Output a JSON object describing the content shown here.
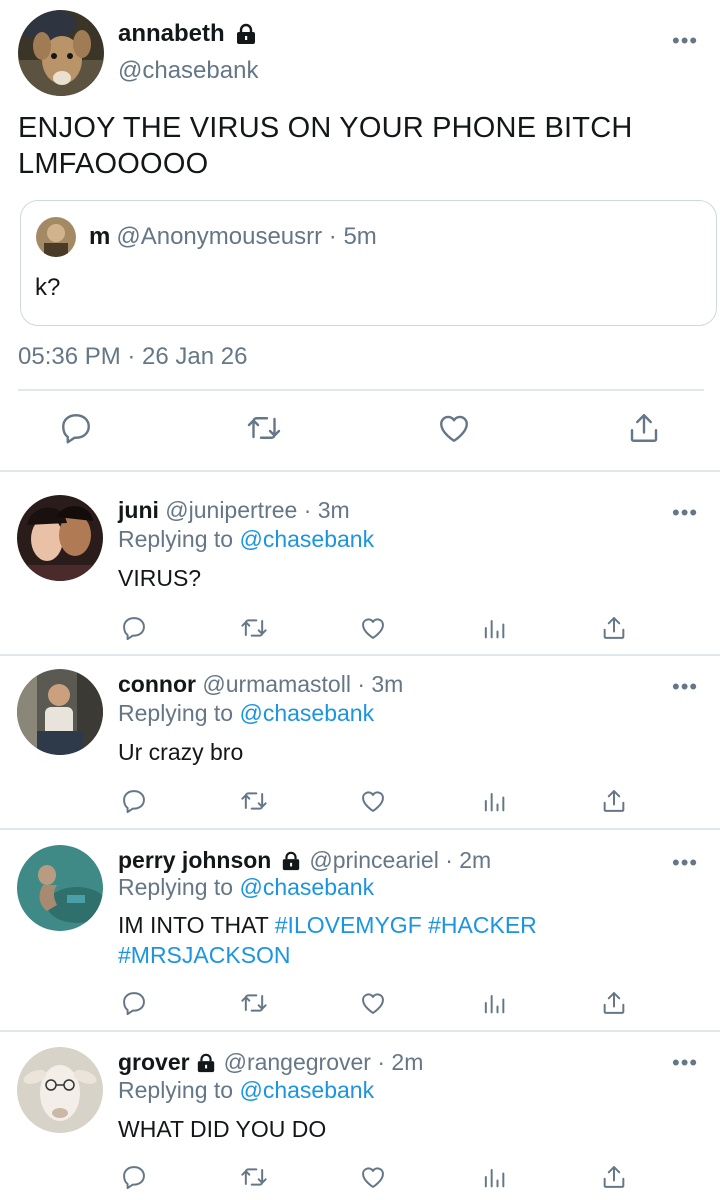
{
  "main_tweet": {
    "name": "annabeth",
    "handle": "@chasebank",
    "text": "ENJOY THE VIRUS ON YOUR PHONE BITCH LMFAOOOOO",
    "more_icon": "more-dots-icon",
    "quoted": {
      "name": "m",
      "handle": "@Anonymouseusrr",
      "time": "· 5m",
      "text": "k?"
    },
    "timestamp": "05:36 PM · 26 Jan 26",
    "actions": [
      "reply-icon",
      "retweet-icon",
      "like-icon",
      "share-icon"
    ]
  },
  "replies": [
    {
      "name": "juni",
      "locked": false,
      "handle": "@junipertree · 3m",
      "replying_label": "Replying to",
      "replying_to": "@chasebank",
      "text": "VIRUS?",
      "hashtags": ""
    },
    {
      "name": "connor",
      "locked": false,
      "handle": "@urmamastoll · 3m",
      "replying_label": "Replying to",
      "replying_to": "@chasebank",
      "text": "Ur crazy bro",
      "hashtags": ""
    },
    {
      "name": "perry johnson",
      "locked": true,
      "handle": "@princeariel · 2m",
      "replying_label": "Replying to",
      "replying_to": "@chasebank",
      "text": "IM INTO THAT",
      "hashtags": "#ILOVEMYGF #HACKER #MRSJACKSON"
    },
    {
      "name": "grover",
      "locked": true,
      "handle": "@rangegrover · 2m",
      "replying_label": "Replying to",
      "replying_to": "@chasebank",
      "text": "WHAT DID YOU DO",
      "hashtags": ""
    }
  ],
  "colors": {
    "text": "#14171a",
    "secondary": "#657786",
    "link": "#1b95e0",
    "divider": "#e1e8ed"
  }
}
